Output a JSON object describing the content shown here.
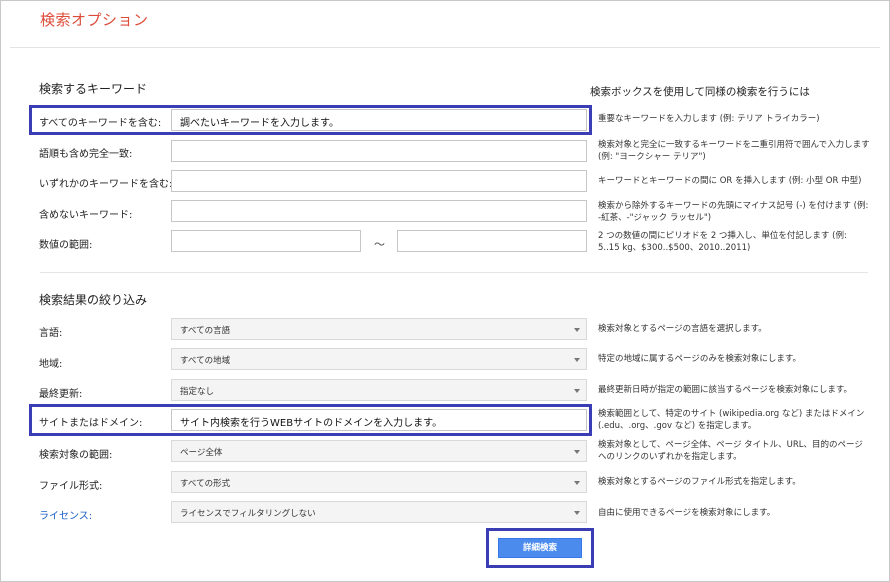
{
  "page": {
    "title": "検索オプション"
  },
  "keywords": {
    "heading": "検索するキーワード",
    "help_heading": "検索ボックスを使用して同様の検索を行うには",
    "rows": [
      {
        "label": "すべてのキーワードを含む:",
        "value": "調べたいキーワードを入力します。",
        "help": "重要なキーワードを入力します (例: テリア トライカラー)"
      },
      {
        "label": "語順も含め完全一致:",
        "value": "",
        "help": "検索対象と完全に一致するキーワードを二重引用符で囲んで入力します (例: \"ヨークシャー テリア\")"
      },
      {
        "label": "いずれかのキーワードを含む:",
        "value": "",
        "help": "キーワードとキーワードの間に OR を挿入します (例: 小型 OR 中型)"
      },
      {
        "label": "含めないキーワード:",
        "value": "",
        "help": "検索から除外するキーワードの先頭にマイナス記号 (-) を付けます (例: -紅茶、-\"ジャック ラッセル\")"
      },
      {
        "label": "数値の範囲:",
        "value_from": "",
        "value_to": "",
        "separator": "～",
        "help": "2 つの数値の間にピリオドを 2 つ挿入し、単位を付記します (例: 5..15 kg、$300..$500、2010..2011)"
      }
    ]
  },
  "filters": {
    "heading": "検索結果の絞り込み",
    "rows": [
      {
        "label": "言語:",
        "value": "すべての言語",
        "help": "検索対象とするページの言語を選択します。"
      },
      {
        "label": "地域:",
        "value": "すべての地域",
        "help": "特定の地域に属するページのみを検索対象にします。"
      },
      {
        "label": "最終更新:",
        "value": "指定なし",
        "help": "最終更新日時が指定の範囲に該当するページを検索対象にします。"
      },
      {
        "label": "サイトまたはドメイン:",
        "value": "サイト内検索を行うWEBサイトのドメインを入力します。",
        "help": "検索範囲として、特定のサイト (wikipedia.org など) またはドメイン (.edu、.org、.gov など) を指定します。"
      },
      {
        "label": "検索対象の範囲:",
        "value": "ページ全体",
        "help": "検索対象として、ページ全体、ページ タイトル、URL、目的のページへのリンクのいずれかを指定します。"
      },
      {
        "label": "ファイル形式:",
        "value": "すべての形式",
        "help": "検索対象とするページのファイル形式を指定します。"
      },
      {
        "label": "ライセンス:",
        "value": "ライセンスでフィルタリングしない",
        "help": "自由に使用できるページを検索対象にします。"
      }
    ]
  },
  "submit": {
    "label": "詳細検索"
  },
  "colors": {
    "title": "#dd4b39",
    "highlight": "#3a3db3",
    "button": "#4a8bed",
    "link": "#1a5fc8"
  }
}
